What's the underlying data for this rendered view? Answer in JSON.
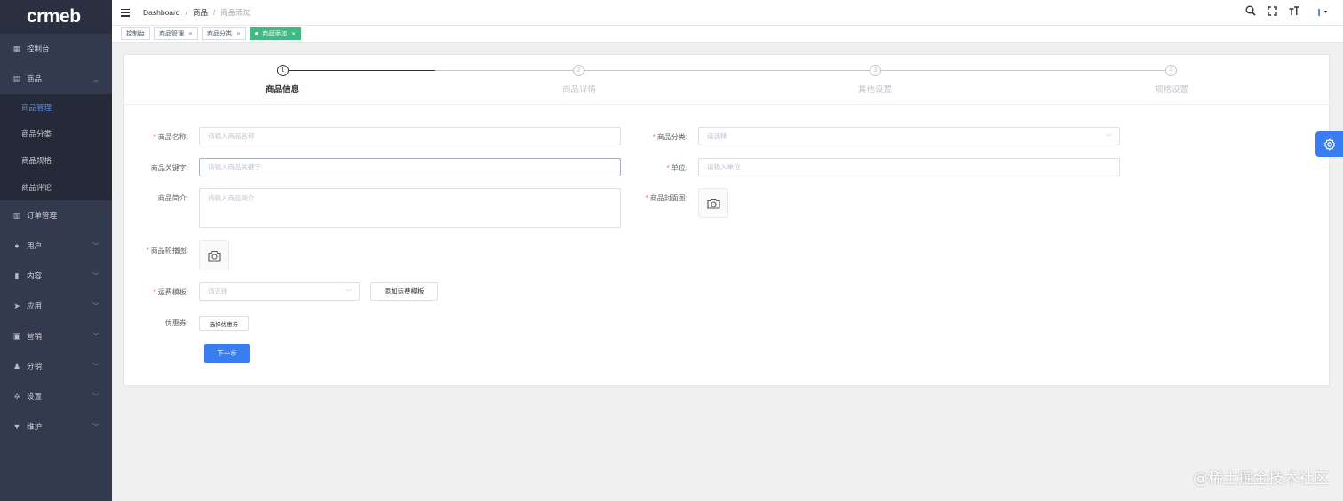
{
  "app": {
    "logo_text": "crmeb"
  },
  "sidebar": {
    "items": [
      {
        "label": "控制台",
        "icon": "dashboard-icon",
        "has_arrow": false
      },
      {
        "label": "商品",
        "icon": "shop-icon",
        "has_arrow": true,
        "expanded": true
      }
    ],
    "submenu": [
      {
        "label": "商品管理",
        "active": true
      },
      {
        "label": "商品分类"
      },
      {
        "label": "商品规格"
      },
      {
        "label": "商品评论"
      }
    ],
    "items_after": [
      {
        "label": "订单管理",
        "icon": "order-icon"
      },
      {
        "label": "用户",
        "icon": "user-icon"
      },
      {
        "label": "内容",
        "icon": "chart-icon"
      },
      {
        "label": "应用",
        "icon": "send-icon"
      },
      {
        "label": "营销",
        "icon": "marketing-icon"
      },
      {
        "label": "分销",
        "icon": "distribution-icon"
      },
      {
        "label": "设置",
        "icon": "gear-icon"
      },
      {
        "label": "维护",
        "icon": "maintain-icon"
      }
    ]
  },
  "header": {
    "breadcrumb": [
      "Dashboard",
      "商品",
      "商品添加"
    ]
  },
  "tags": [
    {
      "label": "控制台",
      "closable": false
    },
    {
      "label": "商品管理",
      "closable": true
    },
    {
      "label": "商品分类",
      "closable": true
    },
    {
      "label": "商品添加",
      "closable": true,
      "active": true
    }
  ],
  "steps": [
    {
      "num": "1",
      "title": "商品信息",
      "active": true
    },
    {
      "num": "2",
      "title": "商品详情"
    },
    {
      "num": "3",
      "title": "其他设置"
    },
    {
      "num": "4",
      "title": "规格设置"
    }
  ],
  "form": {
    "name_label": "商品名称:",
    "name_placeholder": "请输入商品名称",
    "category_label": "商品分类:",
    "category_placeholder": "请选择",
    "keywords_label": "商品关键字:",
    "keywords_placeholder": "请输入商品关键字",
    "unit_label": "单位:",
    "unit_placeholder": "请输入单位",
    "intro_label": "商品简介:",
    "intro_placeholder": "请输入商品简介",
    "cover_label": "商品封面图:",
    "carousel_label": "商品轮播图:",
    "shipping_label": "运费模板:",
    "shipping_placeholder": "请选择",
    "add_shipping_button": "添加运费模板",
    "coupon_label": "优惠券:",
    "coupon_button": "选择优惠券",
    "next_button": "下一步"
  },
  "watermark": "@稀土掘金技术社区",
  "colors": {
    "primary": "#3a7df0",
    "tag_active": "#42b983",
    "sidebar": "#343a4d",
    "required": "#f56c6c"
  }
}
